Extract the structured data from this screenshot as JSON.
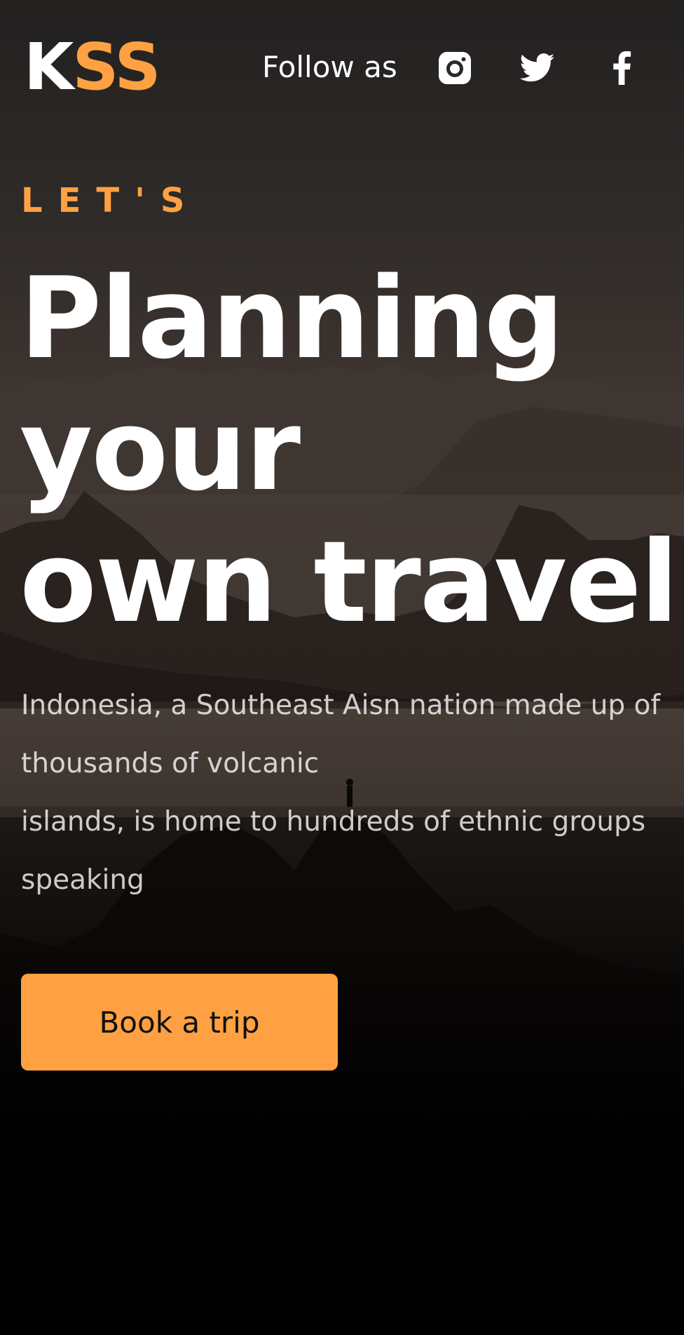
{
  "header": {
    "logo_first": "K",
    "logo_rest": "SS",
    "follow_label": "Follow as",
    "social": [
      {
        "icon": "instagram-icon"
      },
      {
        "icon": "twitter-icon"
      },
      {
        "icon": "facebook-icon"
      }
    ]
  },
  "hero": {
    "kicker": "LET'S",
    "headline_lines": [
      "Planning",
      "your",
      "own travel"
    ],
    "description_lines": [
      "Indonesia, a Southeast Aisn nation made up of",
      "thousands of volcanic",
      "islands, is home to hundreds of ethnic groups",
      "speaking"
    ],
    "cta_label": "Book a trip"
  },
  "colors": {
    "accent": "#ffa142",
    "text": "#ffffff",
    "background": "#000000"
  }
}
